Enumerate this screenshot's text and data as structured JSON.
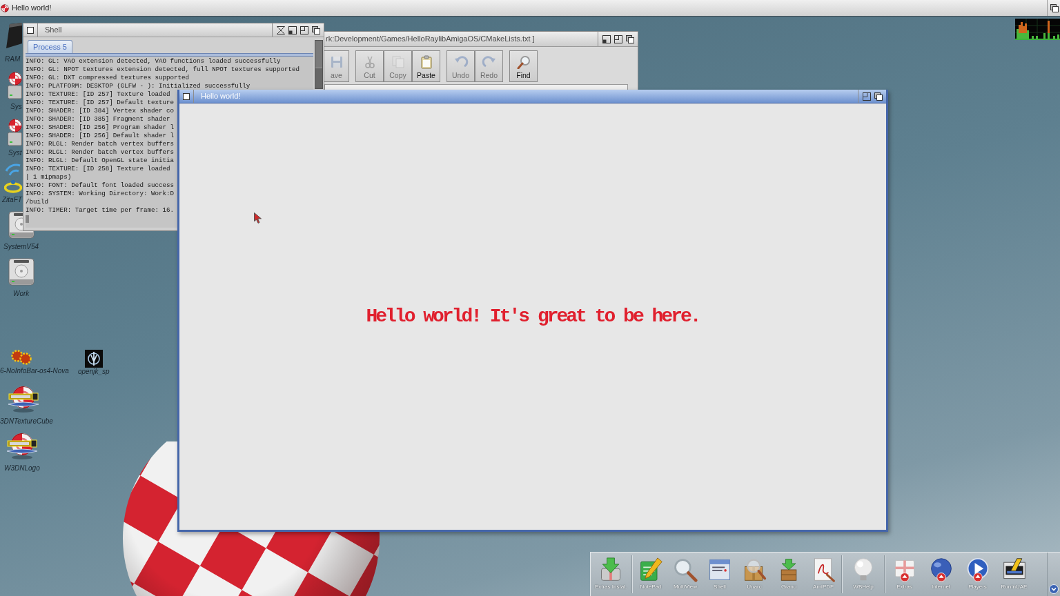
{
  "screen_bar": {
    "title": "Hello world!"
  },
  "desktop_icons": [
    {
      "kind": "ramdisk",
      "label": "RAM"
    },
    {
      "kind": "boing-disk",
      "label": "Sys"
    },
    {
      "kind": "boing-disk",
      "label": "Syst"
    },
    {
      "kind": "wireless",
      "label": "ZitaFT"
    },
    {
      "kind": "harddisk",
      "label": "SystemV54"
    },
    {
      "kind": "harddisk",
      "label": "Work"
    },
    {
      "kind": "gears",
      "label": "6-NoInfoBar-os4-Nova"
    },
    {
      "kind": "emblem",
      "label": "openjk_sp"
    },
    {
      "kind": "warp-ball",
      "label": "3DNTextureCube"
    },
    {
      "kind": "warp-ball",
      "label": "W3DNLogo"
    }
  ],
  "editor_window": {
    "title": "rk:Development/Games/HelloRaylibAmigaOS/CMakeLists.txt ]",
    "active": false,
    "toolbar_groups": [
      {
        "buttons": [
          {
            "kind": "save",
            "label": "ave",
            "disabled": true
          }
        ]
      },
      {
        "buttons": [
          {
            "kind": "cut",
            "label": "Cut",
            "disabled": true
          },
          {
            "kind": "copy",
            "label": "Copy",
            "disabled": true
          },
          {
            "kind": "paste",
            "label": "Paste",
            "disabled": false
          }
        ]
      },
      {
        "buttons": [
          {
            "kind": "undo",
            "label": "Undo",
            "disabled": true
          },
          {
            "kind": "redo",
            "label": "Redo",
            "disabled": true
          }
        ]
      },
      {
        "buttons": [
          {
            "kind": "find",
            "label": "Find",
            "disabled": false
          }
        ]
      }
    ]
  },
  "shell_window": {
    "title": "Shell",
    "active": false,
    "tabs": [
      {
        "label": "Process 5",
        "selected": true
      }
    ],
    "lines": [
      "INFO: GL: VAO extension detected, VAO functions loaded successfully",
      "INFO: GL: NPOT textures extension detected, full NPOT textures supported",
      "INFO: GL: DXT compressed textures supported",
      "INFO: PLATFORM: DESKTOP (GLFW - ): Initialized successfully",
      "INFO: TEXTURE: [ID 257] Texture loaded",
      "INFO: TEXTURE: [ID 257] Default texture",
      "INFO: SHADER: [ID 384] Vertex shader co",
      "INFO: SHADER: [ID 385] Fragment shader",
      "INFO: SHADER: [ID 256] Program shader l",
      "INFO: SHADER: [ID 256] Default shader l",
      "INFO: RLGL: Render batch vertex buffers",
      "INFO: RLGL: Render batch vertex buffers",
      "INFO: RLGL: Default OpenGL state initia",
      "INFO: TEXTURE: [ID 258] Texture loaded",
      "| 1 mipmaps)",
      "INFO: FONT: Default font loaded success",
      "INFO: SYSTEM: Working Directory: Work:D",
      "/build",
      "INFO: TIMER: Target time per frame: 16."
    ]
  },
  "hello_window": {
    "title": "Hello world!",
    "active": true,
    "message": "Hello world! It's great to be here."
  },
  "dock": {
    "groups": [
      {
        "items": [
          {
            "kind": "installer",
            "label": "Extras Instal."
          }
        ]
      },
      {
        "items": [
          {
            "kind": "notepad",
            "label": "NotePad"
          },
          {
            "kind": "magnifier",
            "label": "MultiView"
          },
          {
            "kind": "shell",
            "label": "Shell"
          },
          {
            "kind": "unarchiver",
            "label": "Unarc"
          },
          {
            "kind": "package",
            "label": "Granu"
          },
          {
            "kind": "pdf",
            "label": "AmiPDF"
          }
        ]
      },
      {
        "items": [
          {
            "kind": "bulb",
            "label": "WBHelp"
          }
        ]
      },
      {
        "items": [
          {
            "kind": "giftbox",
            "label": "Extras"
          },
          {
            "kind": "globe",
            "label": "Internet"
          },
          {
            "kind": "player",
            "label": "Players"
          },
          {
            "kind": "emulator",
            "label": "RunInUAE"
          }
        ]
      }
    ]
  }
}
